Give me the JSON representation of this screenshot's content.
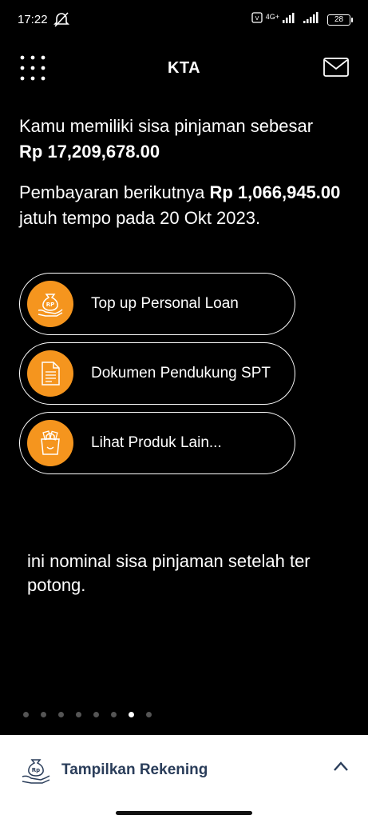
{
  "status": {
    "time": "17:22",
    "network": "4G+",
    "battery": "28"
  },
  "header": {
    "title": "KTA"
  },
  "balance": {
    "prefix": "Kamu memiliki sisa pinjaman sebesar",
    "amount": "Rp 17,209,678.00"
  },
  "payment": {
    "prefix": "Pembayaran berikutnya",
    "amount": "Rp 1,066,945.00",
    "suffix": "jatuh tempo pada 20 Okt 2023."
  },
  "actions": [
    {
      "label": "Top up Personal Loan",
      "icon": "money-bag-hand-icon"
    },
    {
      "label": "Dokumen Pendukung SPT",
      "icon": "document-icon"
    },
    {
      "label": "Lihat Produk Lain...",
      "icon": "shopping-bag-icon"
    }
  ],
  "note": "ini nominal sisa pinjaman setelah ter potong.",
  "pager": {
    "count": 8,
    "active_index": 6
  },
  "bottom_sheet": {
    "label": "Tampilkan Rekening",
    "icon": "money-bag-hand-icon",
    "chevron": "chevron-up-icon"
  },
  "colors": {
    "background": "#000000",
    "accent": "#f5951e",
    "sheet_text": "#2a3d5a"
  }
}
